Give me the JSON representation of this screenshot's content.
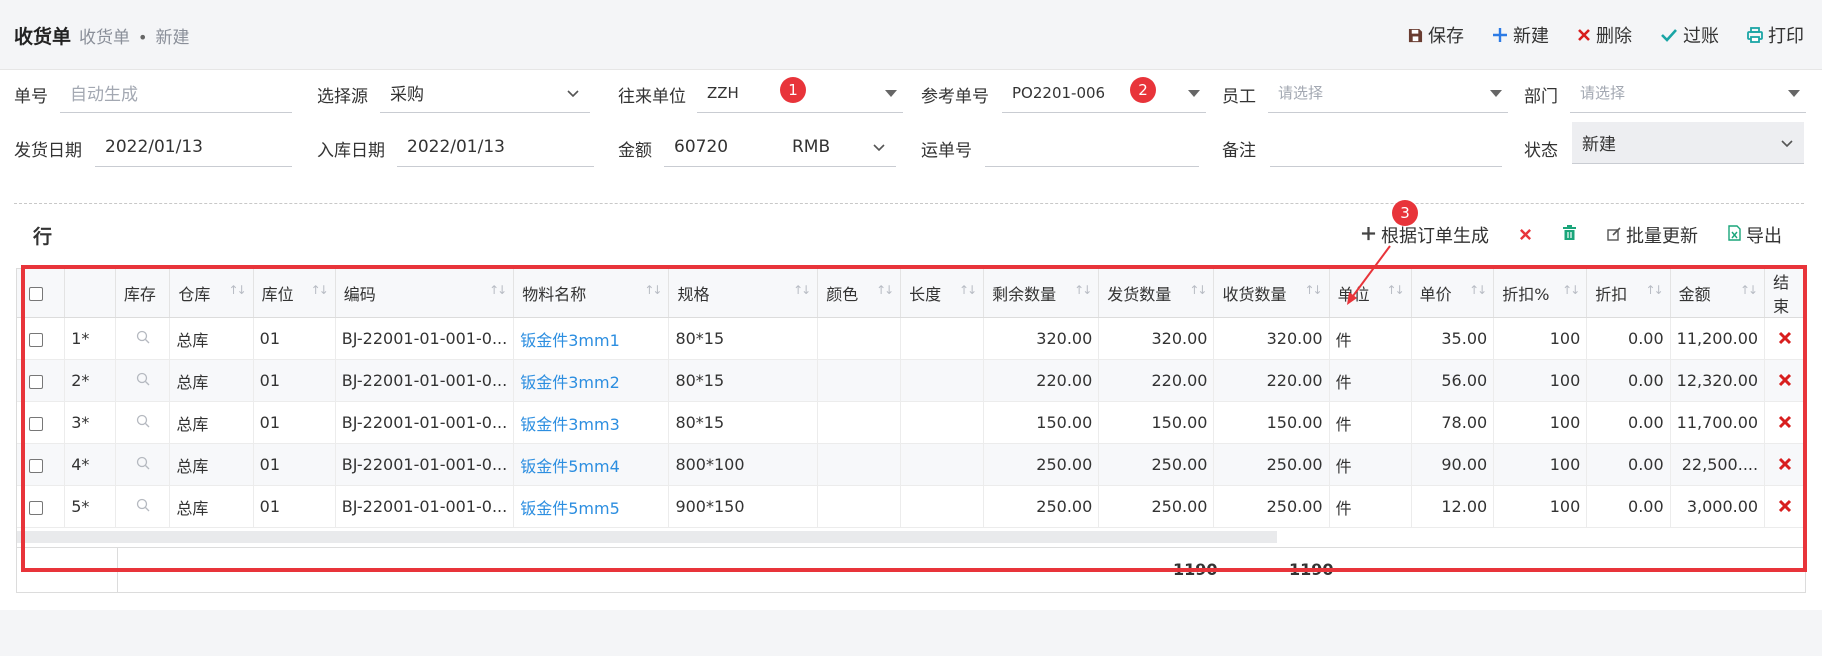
{
  "breadcrumb": {
    "title": "收货单",
    "parent": "收货单",
    "sep": "•",
    "current": "新建"
  },
  "toolbar": {
    "save": "保存",
    "new": "新建",
    "delete": "删除",
    "post": "过账",
    "print": "打印"
  },
  "form": {
    "order_no": {
      "label": "单号",
      "placeholder": "自动生成"
    },
    "source": {
      "label": "选择源",
      "value": "采购"
    },
    "partner": {
      "label": "往来单位",
      "value": "ZZH"
    },
    "ref_no": {
      "label": "参考单号",
      "value": "PO2201-006"
    },
    "employee": {
      "label": "员工",
      "placeholder": "请选择"
    },
    "dept": {
      "label": "部门",
      "placeholder": "请选择"
    },
    "ship_date": {
      "label": "发货日期",
      "value": "2022/01/13"
    },
    "in_date": {
      "label": "入库日期",
      "value": "2022/01/13"
    },
    "amount": {
      "label": "金额",
      "value": "60720",
      "currency": "RMB"
    },
    "waybill": {
      "label": "运单号",
      "value": ""
    },
    "remark": {
      "label": "备注",
      "value": ""
    },
    "status": {
      "label": "状态",
      "value": "新建"
    }
  },
  "badges": [
    "1",
    "2",
    "3"
  ],
  "lines": {
    "title": "行",
    "tools": {
      "generate": "根据订单生成",
      "export": "导出",
      "batch_update": "批量更新"
    },
    "columns": [
      "库存",
      "仓库",
      "库位",
      "编码",
      "物料名称",
      "规格",
      "颜色",
      "长度",
      "剩余数量",
      "发货数量",
      "收货数量",
      "单位",
      "单价",
      "折扣%",
      "折扣",
      "金额",
      "结束"
    ],
    "rows": [
      {
        "no": "1*",
        "warehouse": "总库",
        "location": "01",
        "code": "BJ-22001-01-001-0...",
        "name": "钣金件3mm1",
        "spec": "80*15",
        "color": "",
        "length": "",
        "remain": "320.00",
        "shipped": "320.00",
        "received": "320.00",
        "unit": "件",
        "price": "35.00",
        "discount_pct": "100",
        "discount": "0.00",
        "amount": "11,200.00"
      },
      {
        "no": "2*",
        "warehouse": "总库",
        "location": "01",
        "code": "BJ-22001-01-001-0...",
        "name": "钣金件3mm2",
        "spec": "80*15",
        "color": "",
        "length": "",
        "remain": "220.00",
        "shipped": "220.00",
        "received": "220.00",
        "unit": "件",
        "price": "56.00",
        "discount_pct": "100",
        "discount": "0.00",
        "amount": "12,320.00"
      },
      {
        "no": "3*",
        "warehouse": "总库",
        "location": "01",
        "code": "BJ-22001-01-001-0...",
        "name": "钣金件3mm3",
        "spec": "80*15",
        "color": "",
        "length": "",
        "remain": "150.00",
        "shipped": "150.00",
        "received": "150.00",
        "unit": "件",
        "price": "78.00",
        "discount_pct": "100",
        "discount": "0.00",
        "amount": "11,700.00"
      },
      {
        "no": "4*",
        "warehouse": "总库",
        "location": "01",
        "code": "BJ-22001-01-001-0...",
        "name": "钣金件5mm4",
        "spec": "800*100",
        "color": "",
        "length": "",
        "remain": "250.00",
        "shipped": "250.00",
        "received": "250.00",
        "unit": "件",
        "price": "90.00",
        "discount_pct": "100",
        "discount": "0.00",
        "amount": "22,500...."
      },
      {
        "no": "5*",
        "warehouse": "总库",
        "location": "01",
        "code": "BJ-22001-01-001-0...",
        "name": "钣金件5mm5",
        "spec": "900*150",
        "color": "",
        "length": "",
        "remain": "250.00",
        "shipped": "250.00",
        "received": "250.00",
        "unit": "件",
        "price": "12.00",
        "discount_pct": "100",
        "discount": "0.00",
        "amount": "3,000.00"
      }
    ],
    "totals": {
      "shipped": "1190",
      "received": "1190"
    }
  },
  "colors": {
    "accent_red": "#e8343a",
    "link_blue": "#2c8ee0",
    "post_teal": "#1aa5a5"
  }
}
